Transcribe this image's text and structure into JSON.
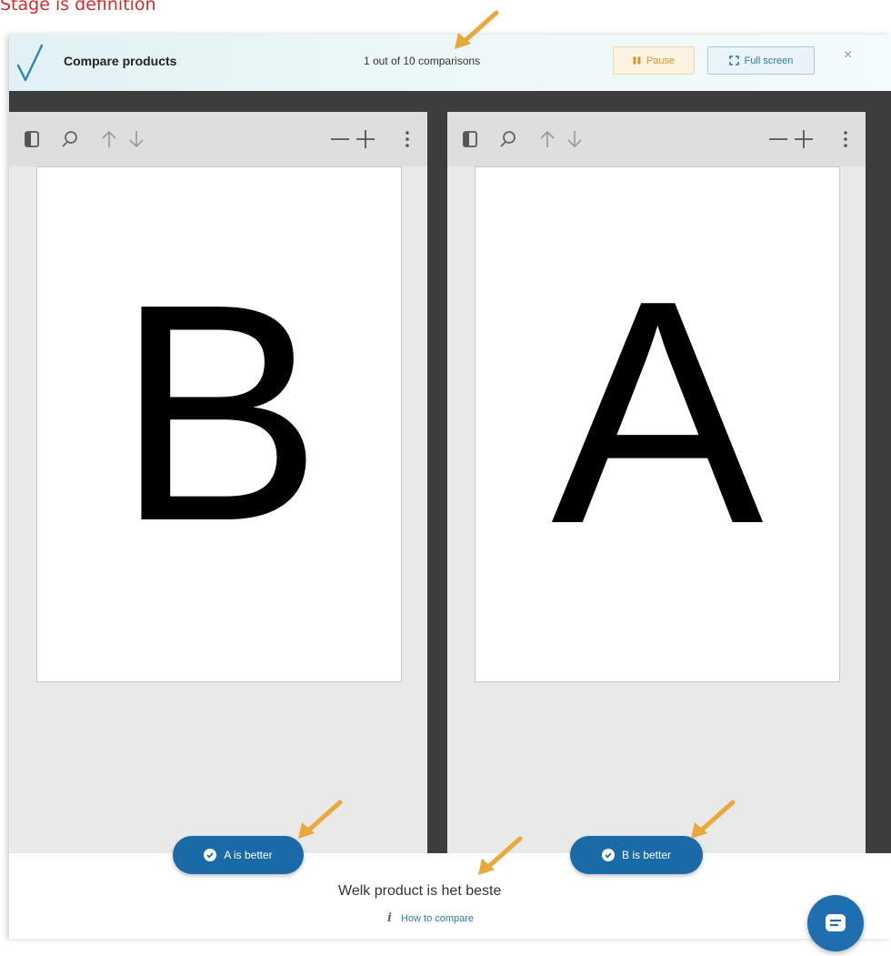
{
  "caption": "Stage is definition",
  "header": {
    "title": "Compare products",
    "counter": "1 out of 10 comparisons",
    "pause_label": "Pause",
    "fullscreen_label": "Full screen",
    "close_symbol": "×"
  },
  "viewers": [
    {
      "letter": "B",
      "tools": [
        "sidebar-icon",
        "search-icon",
        "arrow-up-icon",
        "arrow-down-icon",
        "zoom-out-icon",
        "zoom-in-icon",
        "more-icon"
      ]
    },
    {
      "letter": "A",
      "tools": [
        "sidebar-icon",
        "search-icon",
        "arrow-up-icon",
        "arrow-down-icon",
        "zoom-out-icon",
        "zoom-in-icon",
        "more-icon"
      ]
    }
  ],
  "footer": {
    "vote_a_label": "A is better",
    "vote_b_label": "B is better",
    "question": "Welk product is het beste",
    "how_to_label": "How to compare",
    "info_symbol": "i"
  },
  "colors": {
    "accent_blue": "#1b6aa8",
    "pause_orange": "#d99427",
    "arrow_orange": "#e9a93a",
    "caption_red": "#d42a2a"
  }
}
